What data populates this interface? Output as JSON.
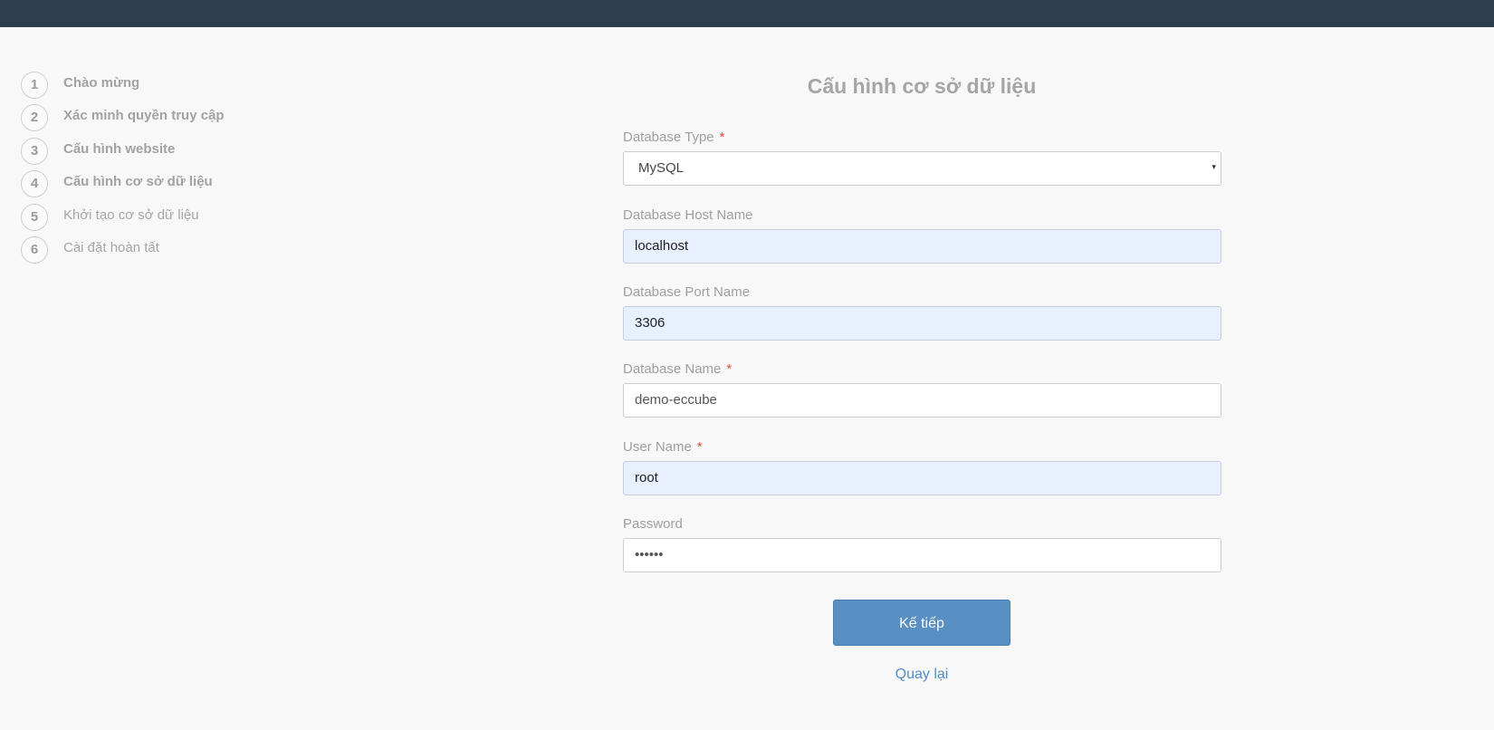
{
  "steps": [
    {
      "number": "1",
      "label": "Chào mừng"
    },
    {
      "number": "2",
      "label": "Xác minh quyền truy cập"
    },
    {
      "number": "3",
      "label": "Cấu hình website"
    },
    {
      "number": "4",
      "label": "Cấu hình cơ sở dữ liệu"
    },
    {
      "number": "5",
      "label": "Khởi tạo cơ sở dữ liệu"
    },
    {
      "number": "6",
      "label": "Cài đặt hoàn tất"
    }
  ],
  "form": {
    "title": "Cấu hình cơ sở dữ liệu",
    "required_mark": "*",
    "db_type": {
      "label": "Database Type",
      "value": "MySQL",
      "caret": "▾"
    },
    "host": {
      "label": "Database Host Name",
      "value": "localhost"
    },
    "port": {
      "label": "Database Port Name",
      "value": "3306"
    },
    "db_name": {
      "label": "Database Name",
      "value": "demo-eccube"
    },
    "user": {
      "label": "User Name",
      "value": "root"
    },
    "password": {
      "label": "Password",
      "value": "••••••"
    }
  },
  "actions": {
    "next_label": "Kế tiếp",
    "back_label": "Quay lại"
  },
  "colors": {
    "topbar": "#2e3e4e",
    "primary_button": "#5a8fc3",
    "link": "#4f8fc6",
    "required": "#e04a3f",
    "autofill": "#e8f0fe"
  }
}
